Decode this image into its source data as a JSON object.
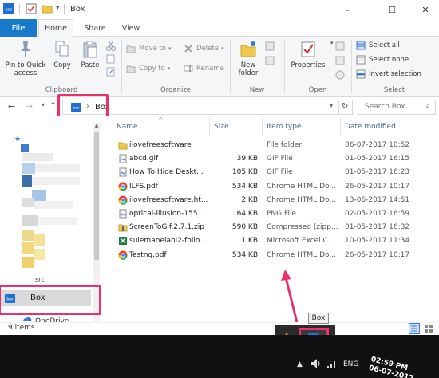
{
  "window": {
    "title": "Box",
    "controls": {
      "minimize": "–",
      "maximize": "☐",
      "close": "✕"
    }
  },
  "tabs": {
    "file": "File",
    "home": "Home",
    "share": "Share",
    "view": "View"
  },
  "ribbon": {
    "clipboard": {
      "pin": "Pin to Quick access",
      "copy": "Copy",
      "paste": "Paste",
      "label": "Clipboard"
    },
    "organize": {
      "move_to": "Move to",
      "copy_to": "Copy to",
      "delete": "Delete",
      "rename": "Rename",
      "label": "Organize"
    },
    "new": {
      "new_folder": "New folder",
      "label": "New"
    },
    "open": {
      "properties": "Properties",
      "label": "Open"
    },
    "select": {
      "select_all": "Select all",
      "select_none": "Select none",
      "invert": "Invert selection",
      "label": "Select"
    }
  },
  "address": {
    "folder": "Box",
    "breadcrumb_sep": "›",
    "search_placeholder": "Search Box"
  },
  "columns": {
    "name": "Name",
    "size": "Size",
    "type": "Item type",
    "date": "Date modified"
  },
  "files": [
    {
      "name": "ilovefreesoftware",
      "size": "",
      "type": "File folder",
      "date": "06-07-2017 10:52",
      "icon": "folder-icon"
    },
    {
      "name": "abcd.gif",
      "size": "39 KB",
      "type": "GIF File",
      "date": "01-05-2017 16:15",
      "icon": "image-file-icon"
    },
    {
      "name": "How To Hide Deskt...",
      "size": "105 KB",
      "type": "GIF File",
      "date": "01-05-2017 16:23",
      "icon": "image-file-icon"
    },
    {
      "name": "ILFS.pdf",
      "size": "534 KB",
      "type": "Chrome HTML Do...",
      "date": "26-05-2017 10:17",
      "icon": "chrome-icon"
    },
    {
      "name": "ilovefreesoftware.ht...",
      "size": "2 KB",
      "type": "Chrome HTML Do...",
      "date": "13-06-2017 14:51",
      "icon": "chrome-icon"
    },
    {
      "name": "optical-illusion-155...",
      "size": "64 KB",
      "type": "PNG File",
      "date": "02-05-2017 16:59",
      "icon": "image-file-icon"
    },
    {
      "name": "ScreenToGif.2.7.1.zip",
      "size": "590 KB",
      "type": "Compressed (zipp...",
      "date": "01-05-2017 16:32",
      "icon": "zip-icon"
    },
    {
      "name": "sulemanelahi2-follo...",
      "size": "1 KB",
      "type": "Microsoft Excel C...",
      "date": "10-05-2017 11:34",
      "icon": "excel-icon"
    },
    {
      "name": "Testng.pdf",
      "size": "534 KB",
      "type": "Chrome HTML Do...",
      "date": "26-05-2017 10:17",
      "icon": "chrome-icon"
    }
  ],
  "nav": {
    "src_partial": "src",
    "box": "Box",
    "onedrive_partial": "OneDrive"
  },
  "status": {
    "item_count": "9 items"
  },
  "tooltip": {
    "text": "Box"
  },
  "taskbar": {
    "lang": "ENG",
    "time": "02:59 PM",
    "date": "06-07-2017"
  },
  "colors": {
    "accent": "#1979ca",
    "highlight": "#e8336a",
    "taskbar": "#111111",
    "box_blue": "#0061d5"
  }
}
